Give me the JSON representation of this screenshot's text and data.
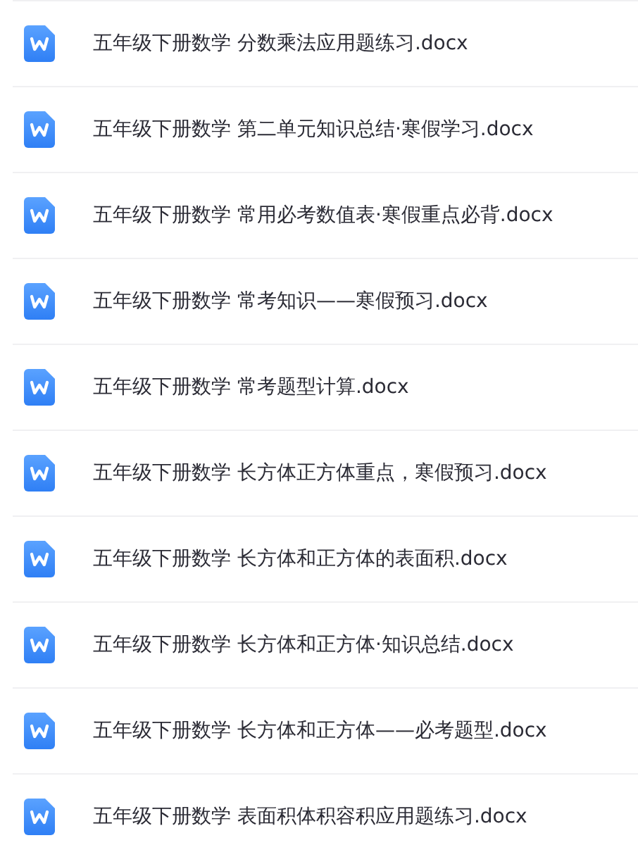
{
  "files": [
    {
      "name": "五年级下册数学 分数乘法应用题练习.docx"
    },
    {
      "name": "五年级下册数学 第二单元知识总结·寒假学习.docx"
    },
    {
      "name": "五年级下册数学 常用必考数值表·寒假重点必背.docx"
    },
    {
      "name": "五年级下册数学 常考知识——寒假预习.docx"
    },
    {
      "name": "五年级下册数学 常考题型计算.docx"
    },
    {
      "name": "五年级下册数学 长方体正方体重点，寒假预习.docx"
    },
    {
      "name": "五年级下册数学 长方体和正方体的表面积.docx"
    },
    {
      "name": "五年级下册数学 长方体和正方体·知识总结.docx"
    },
    {
      "name": "五年级下册数学 长方体和正方体——必考题型.docx"
    },
    {
      "name": "五年级下册数学 表面积体积容积应用题练习.docx"
    }
  ]
}
